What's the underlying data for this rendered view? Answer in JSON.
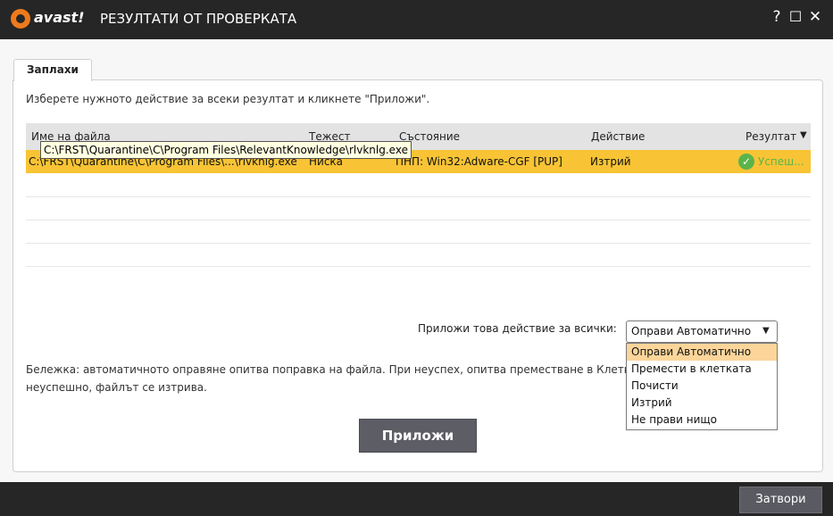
{
  "app": {
    "logo_text": "avast!",
    "title": "РЕЗУЛТАТИ ОТ ПРОВЕРКАТА"
  },
  "window_controls": {
    "help": "?",
    "maximize": "☐",
    "close": "✕"
  },
  "tabs": [
    {
      "label": "Заплахи"
    }
  ],
  "instructions": "Изберете нужното действие за всеки резултат и кликнете \"Приложи\".",
  "table": {
    "columns": [
      "Име на файла",
      "Тежест",
      "Състояние",
      "Действие",
      "Резултат"
    ],
    "rows": [
      {
        "file": "C:\\FRST\\Quarantine\\C\\Program Files\\...\\rlvknlg.exe",
        "severity": "Ниска",
        "status": "ПНП: Win32:Adware-CGF [PUP]",
        "action": "Изтрий",
        "result": "Успеш..."
      }
    ]
  },
  "tooltip": "C:\\FRST\\Quarantine\\C\\Program Files\\RelevantKnowledge\\rlvknlg.exe",
  "apply_all": {
    "label": "Приложи това действие за всички:",
    "selected": "Оправи Автоматично",
    "options": [
      "Оправи Автоматично",
      "Премести в клетката",
      "Почисти",
      "Изтрий",
      "Не прави нищо"
    ]
  },
  "note": "Бележка: автоматичното оправяне опитва поправка на файла. При неуспех, опитва преместване в Клетката, ако и това е неуспешно, файлът се изтрива.",
  "buttons": {
    "apply": "Приложи",
    "close": "Затвори"
  },
  "icons": {
    "logo": "avast-logo-icon",
    "dropdown": "chevron-down-icon",
    "result_ok": "check-circle-icon"
  },
  "colors": {
    "brand": "#ee7a1d",
    "selected_row": "#f8c435",
    "success": "#5bb44a",
    "highlight": "#fbd59a"
  }
}
